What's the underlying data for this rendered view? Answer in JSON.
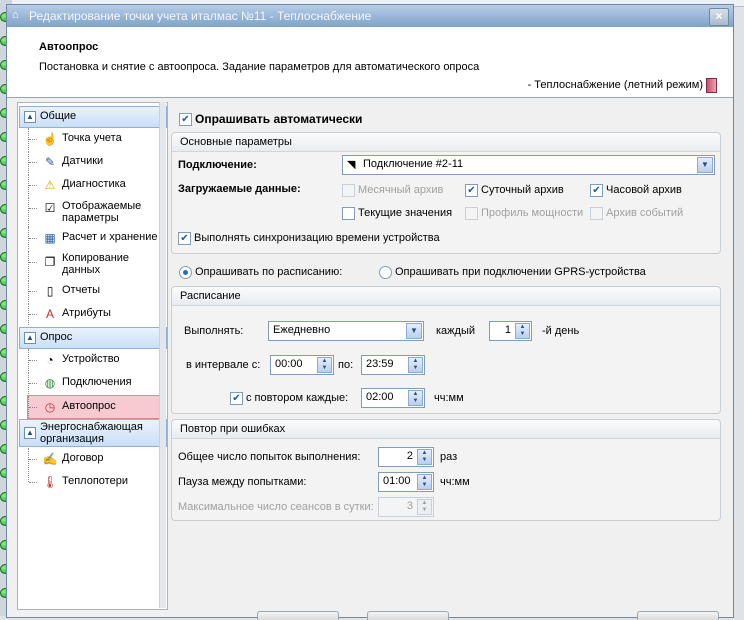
{
  "window": {
    "title": "Редактирование точки учета италмас №11 - Теплоснабжение",
    "close": "×"
  },
  "header": {
    "title": "Автоопрос",
    "description": "Постановка и снятие с автоопроса. Задание параметров для автоматического опроса",
    "object": "- Теплоснабжение (летний режим)"
  },
  "nav": {
    "groups": [
      {
        "label": "Общие",
        "items": [
          "Точка учета",
          "Датчики",
          "Диагностика",
          "Отображаемые параметры",
          "Расчет и хранение",
          "Копирование данных",
          "Отчеты",
          "Атрибуты"
        ]
      },
      {
        "label": "Опрос",
        "items": [
          "Устройство",
          "Подключения",
          "Автоопрос"
        ]
      },
      {
        "label": "Энергоснабжающая организация",
        "items": [
          "Договор",
          "Теплопотери"
        ]
      }
    ],
    "selected": "Автоопрос"
  },
  "auto_poll": {
    "label": "Опрашивать автоматически",
    "checked": true
  },
  "main_params": {
    "title": "Основные параметры",
    "connection_label": "Подключение:",
    "connection_value": "Подключение #2-11",
    "data_label": "Загружаемые данные:",
    "data_options": [
      {
        "label": "Месячный архив",
        "checked": false,
        "enabled": false
      },
      {
        "label": "Суточный архив",
        "checked": true,
        "enabled": true
      },
      {
        "label": "Часовой архив",
        "checked": true,
        "enabled": true
      },
      {
        "label": "Текущие значения",
        "checked": false,
        "enabled": true
      },
      {
        "label": "Профиль мощности",
        "checked": false,
        "enabled": false
      },
      {
        "label": "Архив событий",
        "checked": false,
        "enabled": false
      }
    ],
    "sync_label": "Выполнять синхронизацию времени устройства",
    "sync_checked": true
  },
  "poll_mode": {
    "schedule_label": "Опрашивать по расписанию:",
    "gprs_label": "Опрашивать при подключении GPRS-устройства",
    "selected": "schedule"
  },
  "schedule": {
    "title": "Расписание",
    "run_label": "Выполнять:",
    "run_value": "Ежедневно",
    "every_label": "каждый",
    "every_value": "1",
    "day_suffix": "-й день",
    "interval_label": "в интервале с:",
    "from_value": "00:00",
    "to_label": "по:",
    "to_value": "23:59",
    "repeat_label": "с повтором каждые:",
    "repeat_checked": true,
    "repeat_value": "02:00",
    "repeat_unit": "чч:мм"
  },
  "retry": {
    "title": "Повтор при ошибках",
    "attempts_label": "Общее число попыток выполнения:",
    "attempts_value": "2",
    "attempts_unit": "раз",
    "pause_label": "Пауза между попытками:",
    "pause_value": "01:00",
    "pause_unit": "чч:мм",
    "max_sessions_label": "Максимальное число сеансов в сутки:",
    "max_sessions_value": "3"
  }
}
